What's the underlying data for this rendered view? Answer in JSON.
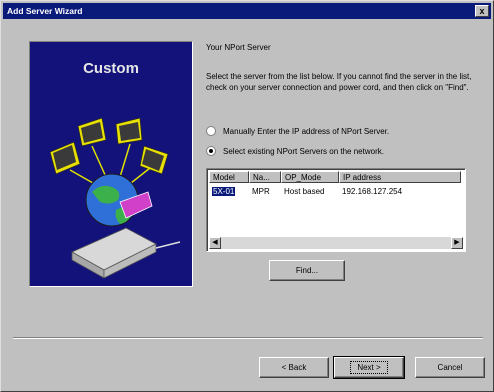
{
  "window": {
    "title": "Add Server Wizard",
    "close_glyph": "x"
  },
  "left_panel": {
    "title": "Custom",
    "icon": "network-computers-globe-illustration"
  },
  "heading": "Your NPort Server",
  "instructions": "Select the server from the list below. If you cannot find the server in the list, check on your server connection and power cord, and then click on \"Find\".",
  "options": [
    {
      "label": "Manually Enter the IP address of NPort Server.",
      "checked": false
    },
    {
      "label": "Select existing NPort Servers on the network.",
      "checked": true
    }
  ],
  "server_list": {
    "columns": [
      "Model",
      "Na...",
      "OP_Mode",
      "IP address"
    ],
    "rows": [
      {
        "model": "5X-01",
        "name": "MPR",
        "op_mode": "Host based",
        "ip": "192.168.127.254"
      }
    ]
  },
  "buttons": {
    "find": "Find...",
    "back": "< Back",
    "next": "Next >",
    "cancel": "Cancel"
  },
  "colors": {
    "title_bar": "#0a1a7a",
    "panel_bg": "#12127a",
    "dialog_bg": "#c0c0c0"
  }
}
